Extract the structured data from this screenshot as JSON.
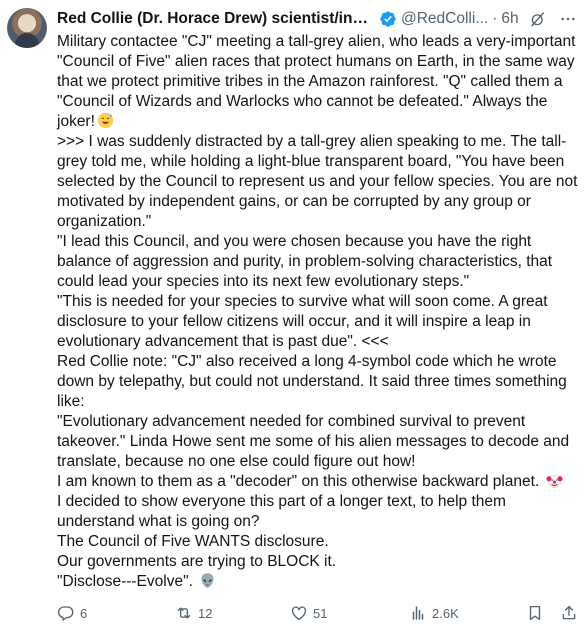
{
  "author": {
    "display_name": "Red Collie (Dr. Horace Drew) scientist/inve...",
    "handle": "@RedColli...",
    "separator": "·",
    "time": "6h"
  },
  "post": {
    "p1": "Military contactee \"CJ\" meeting a tall-grey alien, who leads a very-important \"Council of Five\" alien races that protect humans on Earth, in the same way that we protect primitive tribes in the Amazon rainforest. \"Q\" called them a \"Council of Wizards and Warlocks who cannot be defeated.\" Always the joker!",
    "p2": ">>> I was suddenly distracted by a tall-grey alien speaking to me. The tall-grey told me, while holding a light-blue transparent board, \"You have been selected by the Council to represent us and your fellow species. You are not motivated by independent gains, or can be corrupted by any group or organization.\"",
    "p3": "\"I lead this Council, and you were chosen because you have the right balance of aggression and purity, in problem-solving characteristics, that could lead your species into its next few evolutionary steps.\"",
    "p4": "\"This is needed for your species to survive what will soon come. A great disclosure to your fellow citizens will occur, and it will inspire a leap in evolutionary advancement that is past due\". <<<",
    "p5": "Red Collie note: \"CJ\" also received a long 4-symbol code which he wrote down by telepathy, but could not understand. It said three times something like:",
    "p6": "\"Evolutionary advancement needed for combined survival to prevent takeover.\" Linda Howe sent me some of his alien messages to decode and translate, because no one else could figure out how!",
    "p7": "I am known to them as a \"decoder\" on this otherwise backward planet.",
    "p8": "I decided to show everyone this part of a longer text, to help them understand what is going on?",
    "p9": "The Council of Five WANTS disclosure.",
    "p10": "Our governments are trying to BLOCK it.",
    "p11": "\"Disclose---Evolve\"."
  },
  "emojis": {
    "after_p1": "grinning-sweat-emoji",
    "after_p7": "clown-emoji",
    "after_p11": "alien-emoji"
  },
  "metrics": {
    "replies": "6",
    "reposts": "12",
    "likes": "51",
    "views": "2.6K"
  },
  "colors": {
    "verified_blue": "#1d9bf0",
    "secondary_text": "#536471",
    "primary_text": "#0f1419"
  },
  "icons": [
    "verified-badge-icon",
    "grok-icon",
    "more-icon",
    "reply-icon",
    "repost-icon",
    "like-icon",
    "views-icon",
    "bookmark-icon",
    "share-icon"
  ]
}
